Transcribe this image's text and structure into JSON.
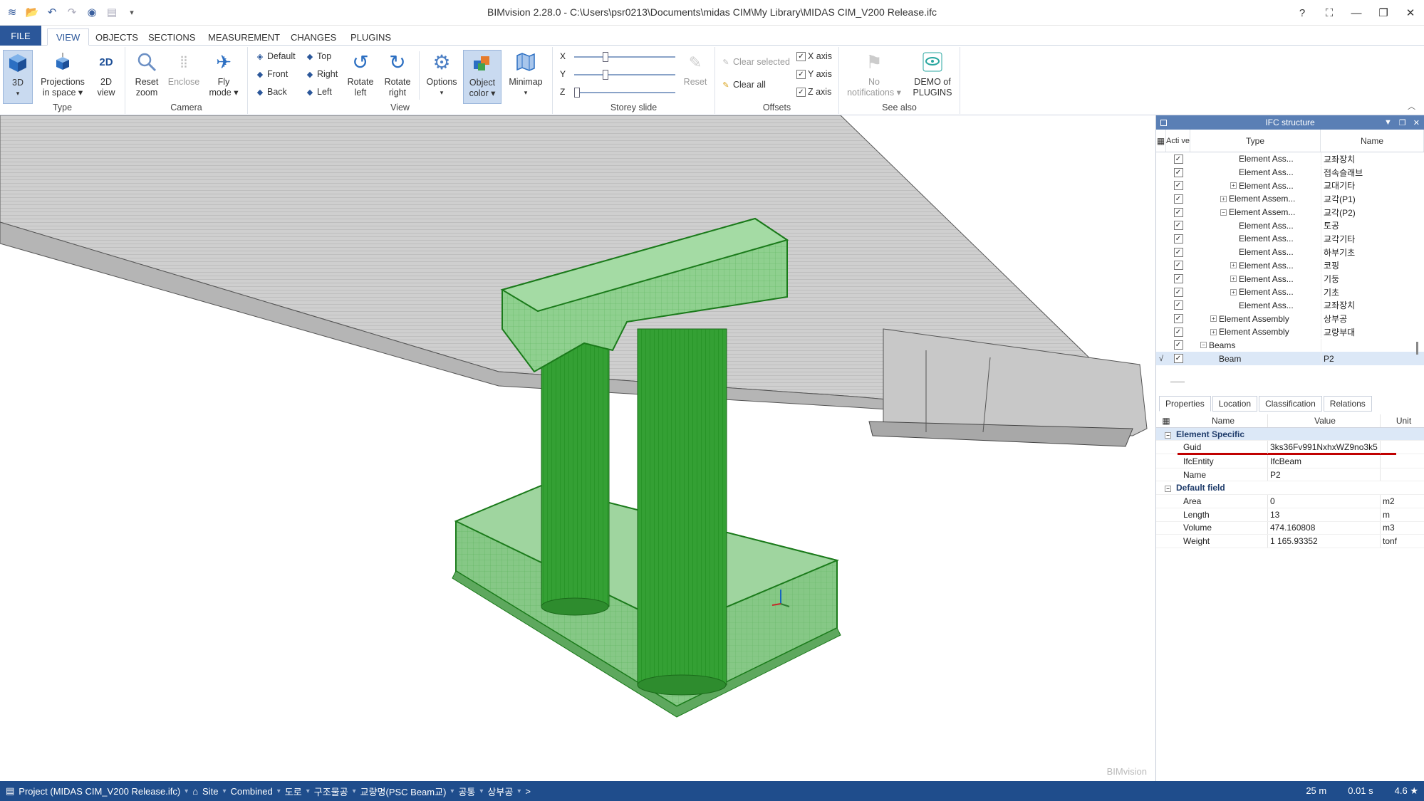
{
  "window": {
    "title": "BIMvision 2.28.0 - C:\\Users\\psr0213\\Documents\\midas CIM\\My Library\\MIDAS CIM_V200 Release.ifc",
    "controls": [
      "?",
      "⛶",
      "—",
      "❐",
      "✕"
    ]
  },
  "tabs": [
    "FILE",
    "VIEW",
    "OBJECTS",
    "SECTIONS",
    "MEASUREMENT",
    "CHANGES",
    "PLUGINS"
  ],
  "active_tab": "VIEW",
  "ribbon": {
    "type": {
      "label": "Type",
      "btn_3d": "3D",
      "btn_proj_l1": "Projections",
      "btn_proj_l2": "in space",
      "btn_2d_l1": "2D",
      "btn_2d_l2": "view"
    },
    "camera": {
      "label": "Camera",
      "reset_l1": "Reset",
      "reset_l2": "zoom",
      "enclose": "Enclose",
      "fly_l1": "Fly",
      "fly_l2": "mode"
    },
    "view": {
      "label": "View",
      "default": "Default",
      "top": "Top",
      "front": "Front",
      "right": "Right",
      "back": "Back",
      "left": "Left",
      "rot_left_l1": "Rotate",
      "rot_left_l2": "left",
      "rot_right_l1": "Rotate",
      "rot_right_l2": "right",
      "options": "Options",
      "objcolor_l1": "Object",
      "objcolor_l2": "color",
      "minimap": "Minimap"
    },
    "storey": {
      "label": "Storey slide",
      "x": "X",
      "y": "Y",
      "z": "Z",
      "reset": "Reset",
      "x_val": 0.3,
      "y_val": 0.3,
      "z_val": 0.0
    },
    "offsets": {
      "label": "Offsets",
      "clear_selected": "Clear selected",
      "clear_all": "Clear all",
      "x_axis": "X axis",
      "y_axis": "Y axis",
      "z_axis": "Z axis"
    },
    "see_also": {
      "label": "See also",
      "no_notif_l1": "No",
      "no_notif_l2": "notifications",
      "demo_l1": "DEMO of",
      "demo_l2": "PLUGINS"
    }
  },
  "viewport": {
    "watermark": "BIMvision"
  },
  "ifc_panel": {
    "title": "IFC structure",
    "columns": {
      "active": "Acti ve",
      "type": "Type",
      "name": "Name"
    },
    "rows": [
      {
        "indent": 4,
        "exp": "",
        "type": "Element Ass...",
        "name": "교좌장치"
      },
      {
        "indent": 4,
        "exp": "",
        "type": "Element Ass...",
        "name": "접속슬래브"
      },
      {
        "indent": 4,
        "exp": "+",
        "type": "Element Ass...",
        "name": "교대기타"
      },
      {
        "indent": 3,
        "exp": "+",
        "type": "Element Assem...",
        "name": "교각(P1)"
      },
      {
        "indent": 3,
        "exp": "−",
        "type": "Element Assem...",
        "name": "교각(P2)"
      },
      {
        "indent": 4,
        "exp": "",
        "type": "Element Ass...",
        "name": "토공"
      },
      {
        "indent": 4,
        "exp": "",
        "type": "Element Ass...",
        "name": "교각기타"
      },
      {
        "indent": 4,
        "exp": "",
        "type": "Element Ass...",
        "name": "하부기초"
      },
      {
        "indent": 4,
        "exp": "+",
        "type": "Element Ass...",
        "name": "코핑"
      },
      {
        "indent": 4,
        "exp": "+",
        "type": "Element Ass...",
        "name": "기둥"
      },
      {
        "indent": 4,
        "exp": "+",
        "type": "Element Ass...",
        "name": "기초"
      },
      {
        "indent": 4,
        "exp": "",
        "type": "Element Ass...",
        "name": "교좌장치"
      },
      {
        "indent": 2,
        "exp": "+",
        "type": "Element Assembly",
        "name": "상부공"
      },
      {
        "indent": 2,
        "exp": "+",
        "type": "Element Assembly",
        "name": "교량부대"
      },
      {
        "indent": 1,
        "exp": "−",
        "type": "Beams",
        "name": ""
      },
      {
        "indent": 2,
        "exp": "",
        "type": "Beam",
        "name": "P2",
        "selected": true,
        "mark": "√"
      }
    ]
  },
  "props_panel": {
    "tabs": [
      "Properties",
      "Location",
      "Classification",
      "Relations"
    ],
    "columns": {
      "name": "Name",
      "value": "Value",
      "unit": "Unit"
    },
    "categories": [
      {
        "title": "Element Specific",
        "rows": [
          {
            "name": "Guid",
            "value": "3ks36Fv991NxhxWZ9no3k5",
            "unit": ""
          },
          {
            "name": "IfcEntity",
            "value": "IfcBeam",
            "unit": ""
          },
          {
            "name": "Name",
            "value": "P2",
            "unit": ""
          }
        ]
      },
      {
        "title": "Default field",
        "rows": [
          {
            "name": "Area",
            "value": "0",
            "unit": "m2"
          },
          {
            "name": "Length",
            "value": "13",
            "unit": "m"
          },
          {
            "name": "Volume",
            "value": "474.160808",
            "unit": "m3"
          },
          {
            "name": "Weight",
            "value": "1 165.93352",
            "unit": "tonf"
          }
        ]
      }
    ]
  },
  "statusbar": {
    "project": "Project (MIDAS CIM_V200 Release.ifc)",
    "crumbs": [
      "Site",
      "Combined",
      "도로",
      "구조물공",
      "교량명(PSC Beam교)",
      "공통",
      "상부공",
      ">"
    ],
    "scale": "25 m",
    "time": "0.01 s",
    "fps": "4.6 ★"
  }
}
